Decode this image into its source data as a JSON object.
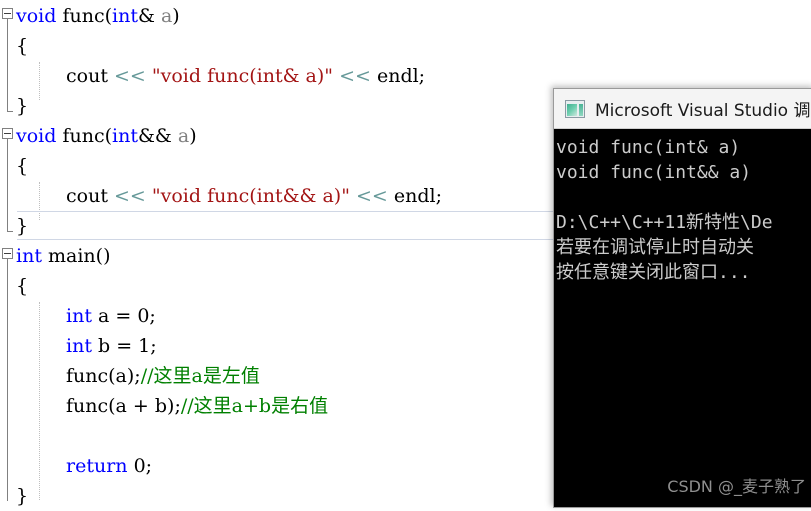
{
  "editor": {
    "lines": [
      {
        "indent": 0,
        "fold": true,
        "segments": [
          {
            "t": "void ",
            "c": "kw"
          },
          {
            "t": "func",
            "c": "plain"
          },
          {
            "t": "(",
            "c": "plain"
          },
          {
            "t": "int",
            "c": "kw"
          },
          {
            "t": "& ",
            "c": "plain"
          },
          {
            "t": "a",
            "c": "param"
          },
          {
            "t": ")",
            "c": "plain"
          }
        ]
      },
      {
        "indent": 0,
        "fold": false,
        "segments": [
          {
            "t": "{",
            "c": "plain"
          }
        ]
      },
      {
        "indent": 2,
        "fold": false,
        "segments": [
          {
            "t": "cout ",
            "c": "plain"
          },
          {
            "t": "<<",
            "c": "op"
          },
          {
            "t": " ",
            "c": "plain"
          },
          {
            "t": "\"void func(int& a)\"",
            "c": "str"
          },
          {
            "t": " ",
            "c": "plain"
          },
          {
            "t": "<<",
            "c": "op"
          },
          {
            "t": " endl;",
            "c": "plain"
          }
        ]
      },
      {
        "indent": 0,
        "fold": false,
        "segments": [
          {
            "t": "}",
            "c": "plain"
          }
        ]
      },
      {
        "indent": 0,
        "fold": true,
        "segments": [
          {
            "t": "void ",
            "c": "kw"
          },
          {
            "t": "func",
            "c": "plain"
          },
          {
            "t": "(",
            "c": "plain"
          },
          {
            "t": "int",
            "c": "kw"
          },
          {
            "t": "&& ",
            "c": "plain"
          },
          {
            "t": "a",
            "c": "param"
          },
          {
            "t": ")",
            "c": "plain"
          }
        ]
      },
      {
        "indent": 0,
        "fold": false,
        "segments": [
          {
            "t": "{",
            "c": "plain"
          }
        ]
      },
      {
        "indent": 2,
        "fold": false,
        "segments": [
          {
            "t": "cout ",
            "c": "plain"
          },
          {
            "t": "<<",
            "c": "op"
          },
          {
            "t": " ",
            "c": "plain"
          },
          {
            "t": "\"void func(int&& a)\"",
            "c": "str"
          },
          {
            "t": " ",
            "c": "plain"
          },
          {
            "t": "<<",
            "c": "op"
          },
          {
            "t": " endl;",
            "c": "plain"
          }
        ]
      },
      {
        "indent": 0,
        "fold": false,
        "segments": [
          {
            "t": "}",
            "c": "plain"
          }
        ]
      },
      {
        "indent": 0,
        "fold": true,
        "segments": [
          {
            "t": "int ",
            "c": "kw"
          },
          {
            "t": "main()",
            "c": "plain"
          }
        ]
      },
      {
        "indent": 0,
        "fold": false,
        "segments": [
          {
            "t": "{",
            "c": "plain"
          }
        ]
      },
      {
        "indent": 2,
        "fold": false,
        "segments": [
          {
            "t": "int",
            "c": "kw"
          },
          {
            "t": " a = 0;",
            "c": "plain"
          }
        ]
      },
      {
        "indent": 2,
        "fold": false,
        "segments": [
          {
            "t": "int",
            "c": "kw"
          },
          {
            "t": " b = 1;",
            "c": "plain"
          }
        ]
      },
      {
        "indent": 2,
        "fold": false,
        "segments": [
          {
            "t": "func(a);",
            "c": "plain"
          },
          {
            "t": "//这里a是左值",
            "c": "cmt"
          }
        ]
      },
      {
        "indent": 2,
        "fold": false,
        "segments": [
          {
            "t": "func(a + b);",
            "c": "plain"
          },
          {
            "t": "//这里a+b是右值",
            "c": "cmt"
          }
        ]
      },
      {
        "indent": 2,
        "fold": false,
        "segments": []
      },
      {
        "indent": 2,
        "fold": false,
        "segments": [
          {
            "t": "return",
            "c": "kw"
          },
          {
            "t": " 0;",
            "c": "plain"
          }
        ]
      },
      {
        "indent": 0,
        "fold": false,
        "segments": [
          {
            "t": "}",
            "c": "plain"
          }
        ]
      }
    ],
    "colors": {
      "keyword": "#0000ff",
      "string": "#a31515",
      "comment": "#008000",
      "operator": "#669999",
      "parameter": "#808080",
      "background": "#ffffff"
    },
    "current_line_index": 7
  },
  "console": {
    "title": "Microsoft Visual Studio 调",
    "icon": "console-window-icon",
    "lines": [
      "void func(int& a)",
      "void func(int&& a)",
      "",
      "D:\\C++\\C++11新特性\\De",
      "若要在调试停止时自动关",
      "按任意键关闭此窗口..."
    ],
    "watermark": "CSDN @_麦子熟了",
    "background": "#000000",
    "text_color": "#cccccc"
  }
}
